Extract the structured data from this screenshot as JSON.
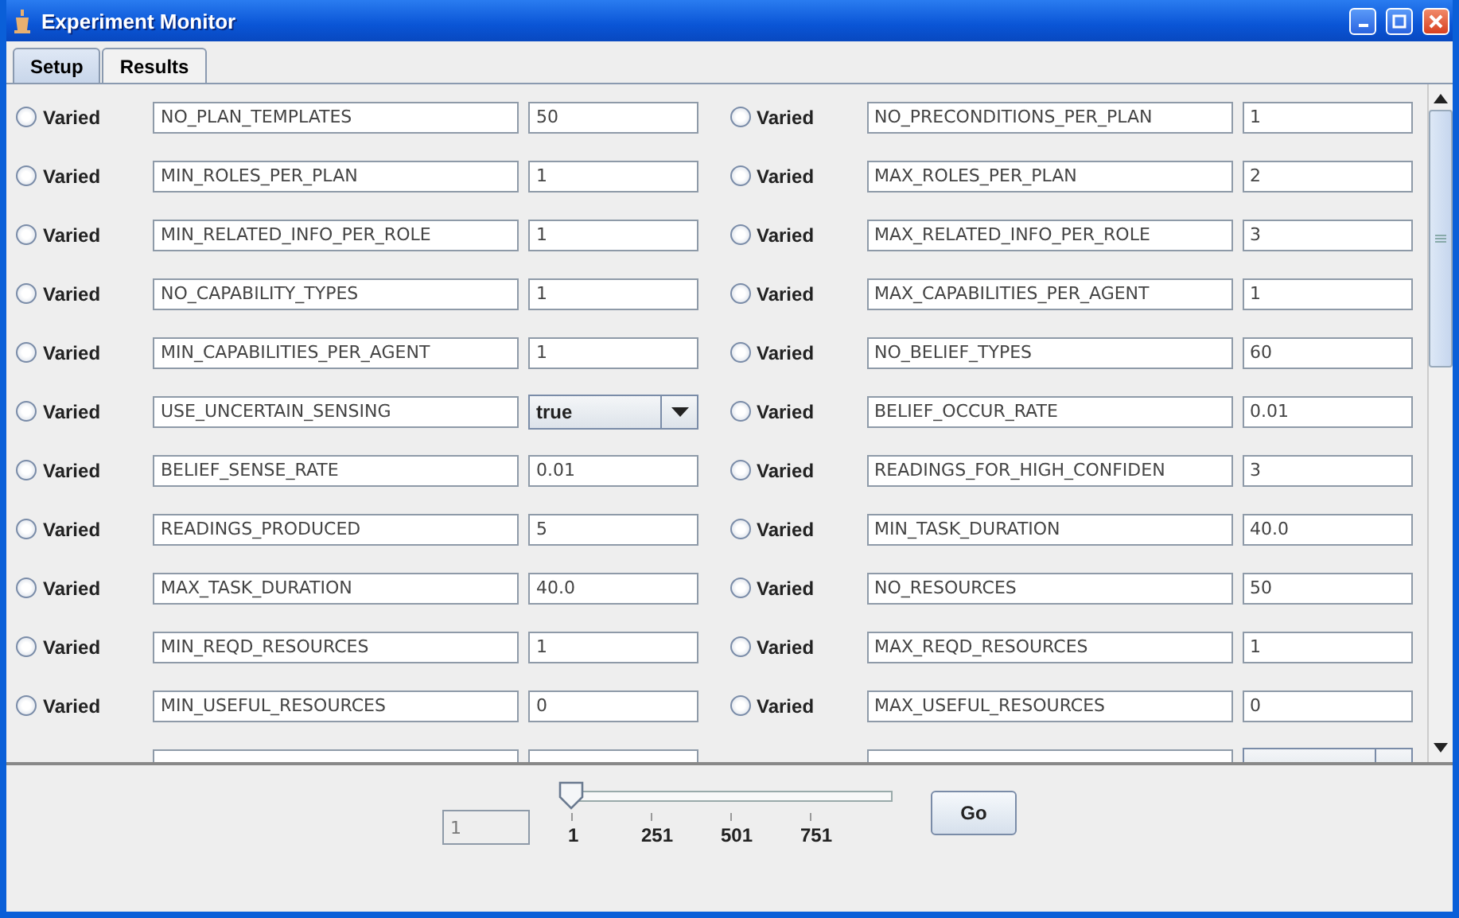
{
  "window": {
    "title": "Experiment Monitor"
  },
  "tabs": [
    {
      "label": "Setup",
      "selected": true
    },
    {
      "label": "Results",
      "selected": false
    }
  ],
  "parameters": [
    {
      "varied_label": "Varied",
      "selected": false,
      "name": "NO_PLAN_TEMPLATES",
      "kind": "text",
      "value": "50"
    },
    {
      "varied_label": "Varied",
      "selected": false,
      "name": "NO_PRECONDITIONS_PER_PLAN",
      "kind": "text",
      "value": "1"
    },
    {
      "varied_label": "Varied",
      "selected": false,
      "name": "MIN_ROLES_PER_PLAN",
      "kind": "text",
      "value": "1"
    },
    {
      "varied_label": "Varied",
      "selected": false,
      "name": "MAX_ROLES_PER_PLAN",
      "kind": "text",
      "value": "2"
    },
    {
      "varied_label": "Varied",
      "selected": false,
      "name": "MIN_RELATED_INFO_PER_ROLE",
      "kind": "text",
      "value": "1"
    },
    {
      "varied_label": "Varied",
      "selected": false,
      "name": "MAX_RELATED_INFO_PER_ROLE",
      "kind": "text",
      "value": "3"
    },
    {
      "varied_label": "Varied",
      "selected": false,
      "name": "NO_CAPABILITY_TYPES",
      "kind": "text",
      "value": "1"
    },
    {
      "varied_label": "Varied",
      "selected": false,
      "name": "MAX_CAPABILITIES_PER_AGENT",
      "kind": "text",
      "value": "1"
    },
    {
      "varied_label": "Varied",
      "selected": false,
      "name": "MIN_CAPABILITIES_PER_AGENT",
      "kind": "text",
      "value": "1"
    },
    {
      "varied_label": "Varied",
      "selected": false,
      "name": "NO_BELIEF_TYPES",
      "kind": "text",
      "value": "60"
    },
    {
      "varied_label": "Varied",
      "selected": false,
      "name": "USE_UNCERTAIN_SENSING",
      "kind": "combo",
      "value": "true"
    },
    {
      "varied_label": "Varied",
      "selected": false,
      "name": "BELIEF_OCCUR_RATE",
      "kind": "text",
      "value": "0.01"
    },
    {
      "varied_label": "Varied",
      "selected": false,
      "name": "BELIEF_SENSE_RATE",
      "kind": "text",
      "value": "0.01"
    },
    {
      "varied_label": "Varied",
      "selected": false,
      "name": "READINGS_FOR_HIGH_CONFIDEN",
      "kind": "text",
      "value": "3"
    },
    {
      "varied_label": "Varied",
      "selected": false,
      "name": "READINGS_PRODUCED",
      "kind": "text",
      "value": "5"
    },
    {
      "varied_label": "Varied",
      "selected": false,
      "name": "MIN_TASK_DURATION",
      "kind": "text",
      "value": "40.0"
    },
    {
      "varied_label": "Varied",
      "selected": false,
      "name": "MAX_TASK_DURATION",
      "kind": "text",
      "value": "40.0"
    },
    {
      "varied_label": "Varied",
      "selected": false,
      "name": "NO_RESOURCES",
      "kind": "text",
      "value": "50"
    },
    {
      "varied_label": "Varied",
      "selected": false,
      "name": "MIN_REQD_RESOURCES",
      "kind": "text",
      "value": "1"
    },
    {
      "varied_label": "Varied",
      "selected": false,
      "name": "MAX_REQD_RESOURCES",
      "kind": "text",
      "value": "1"
    },
    {
      "varied_label": "Varied",
      "selected": false,
      "name": "MIN_USEFUL_RESOURCES",
      "kind": "text",
      "value": "0"
    },
    {
      "varied_label": "Varied",
      "selected": false,
      "name": "MAX_USEFUL_RESOURCES",
      "kind": "text",
      "value": "0"
    }
  ],
  "cut_off_row": [
    {
      "kind": "text"
    },
    {
      "kind": "combo"
    }
  ],
  "run_control": {
    "run_field": {
      "value": "1",
      "disabled": true
    },
    "slider": {
      "level": 0,
      "tick_labels": [
        "1",
        "251",
        "501",
        "751"
      ]
    },
    "go_button": "Go"
  }
}
